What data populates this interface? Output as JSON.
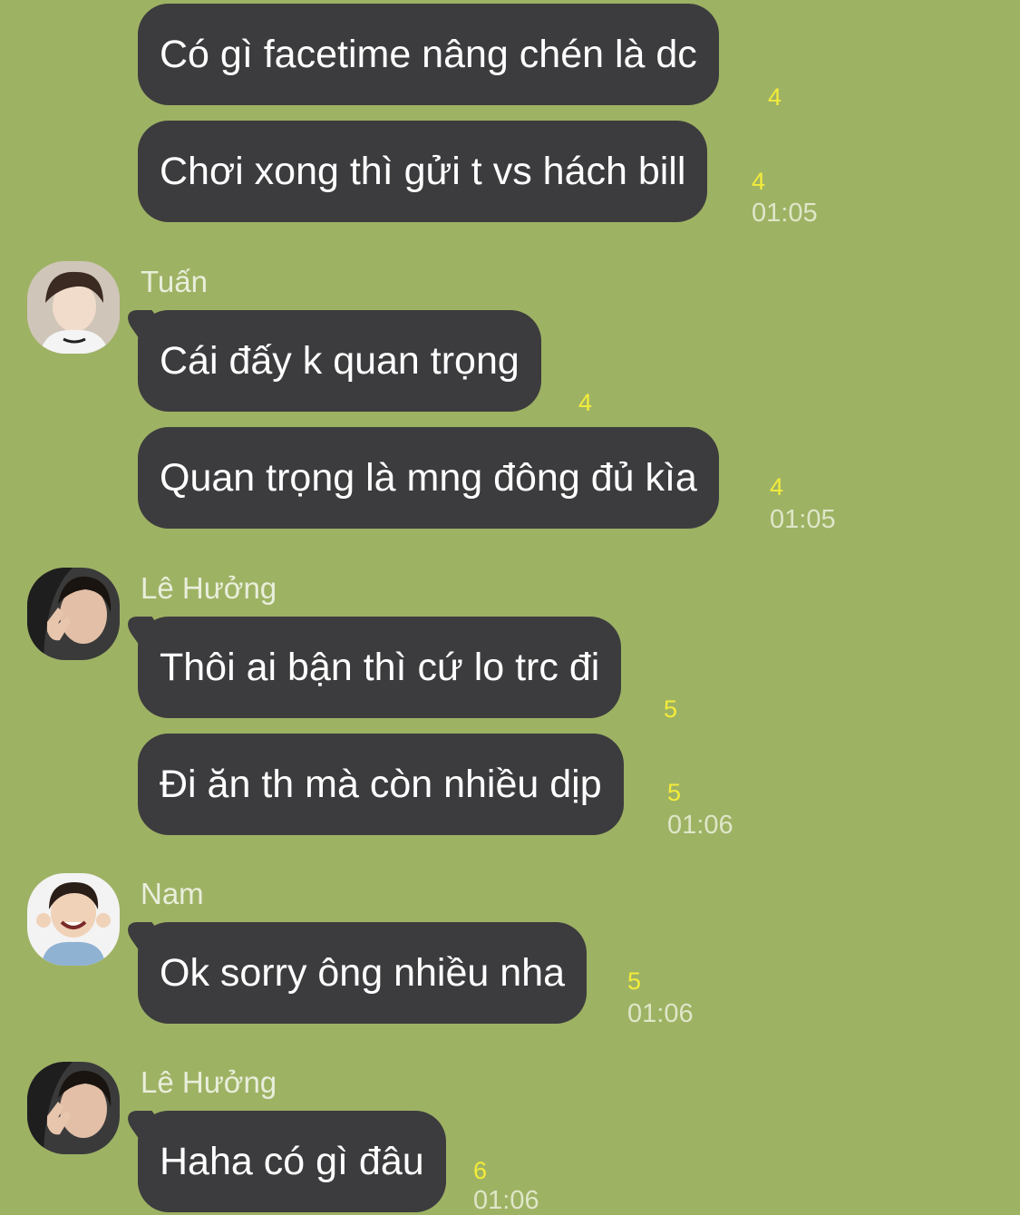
{
  "messages": [
    {
      "text": "Có gì facetime nâng chén là dc",
      "read": "4"
    },
    {
      "text": "Chơi xong thì gửi t vs hách bill",
      "read": "4",
      "time": "01:05"
    },
    {
      "text": "Cái đấy k quan trọng",
      "read": "4"
    },
    {
      "text": "Quan trọng là mng đông đủ kìa",
      "read": "4",
      "time": "01:05"
    },
    {
      "text": "Thôi ai bận thì cứ lo trc đi",
      "read": "5"
    },
    {
      "text": "Đi ăn th mà còn nhiều dịp",
      "read": "5",
      "time": "01:06"
    },
    {
      "text": "Ok sorry ông nhiều nha",
      "read": "5",
      "time": "01:06"
    },
    {
      "text": "Haha có gì đâu",
      "read": "6",
      "time": "01:06"
    }
  ],
  "senders": [
    "Tuấn",
    "Lê Hưởng",
    "Nam",
    "Lê Hưởng"
  ],
  "avatars": [
    "boy-avatar",
    "girl-peace-sign-avatar",
    "child-smiling-avatar",
    "girl-peace-sign-avatar"
  ],
  "colors": {
    "background": "#9eb264",
    "bubble": "#3c3c3e",
    "read_count": "#f3ec3a",
    "timestamp": "#dfe6c8"
  }
}
